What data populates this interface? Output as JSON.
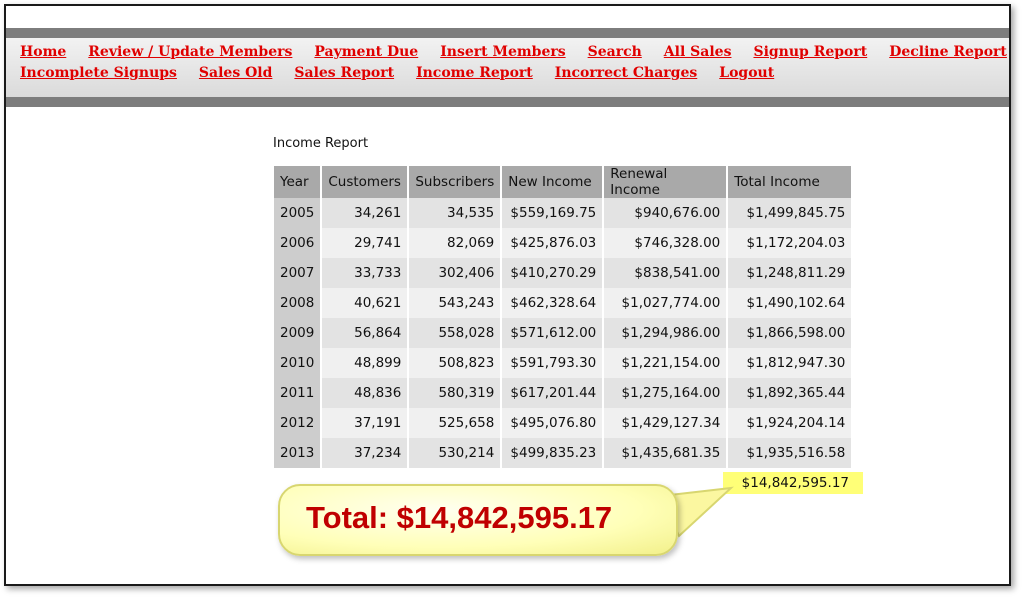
{
  "nav": {
    "row1": [
      "Home",
      "Review / Update Members",
      "Payment Due",
      "Insert Members",
      "Search",
      "All Sales",
      "Signup Report",
      "Decline Report"
    ],
    "row2": [
      "Incomplete Signups",
      "Sales Old",
      "Sales Report",
      "Income Report",
      "Incorrect Charges",
      "Logout"
    ]
  },
  "report": {
    "title": "Income Report",
    "columns": [
      "Year",
      "Customers",
      "Subscribers",
      "New Income",
      "Renewal Income",
      "Total Income"
    ],
    "rows": [
      [
        "2005",
        "34,261",
        "34,535",
        "$559,169.75",
        "$940,676.00",
        "$1,499,845.75"
      ],
      [
        "2006",
        "29,741",
        "82,069",
        "$425,876.03",
        "$746,328.00",
        "$1,172,204.03"
      ],
      [
        "2007",
        "33,733",
        "302,406",
        "$410,270.29",
        "$838,541.00",
        "$1,248,811.29"
      ],
      [
        "2008",
        "40,621",
        "543,243",
        "$462,328.64",
        "$1,027,774.00",
        "$1,490,102.64"
      ],
      [
        "2009",
        "56,864",
        "558,028",
        "$571,612.00",
        "$1,294,986.00",
        "$1,866,598.00"
      ],
      [
        "2010",
        "48,899",
        "508,823",
        "$591,793.30",
        "$1,221,154.00",
        "$1,812,947.30"
      ],
      [
        "2011",
        "48,836",
        "580,319",
        "$617,201.44",
        "$1,275,164.00",
        "$1,892,365.44"
      ],
      [
        "2012",
        "37,191",
        "525,658",
        "$495,076.80",
        "$1,429,127.34",
        "$1,924,204.14"
      ],
      [
        "2013",
        "37,234",
        "530,214",
        "$499,835.23",
        "$1,435,681.35",
        "$1,935,516.58"
      ]
    ],
    "grand_total": "$14,842,595.17"
  },
  "callout": {
    "text": "Total: $14,842,595.17"
  },
  "colors": {
    "nav_link": "#e00000",
    "highlight": "#ffff77",
    "callout_text": "#c00000"
  }
}
